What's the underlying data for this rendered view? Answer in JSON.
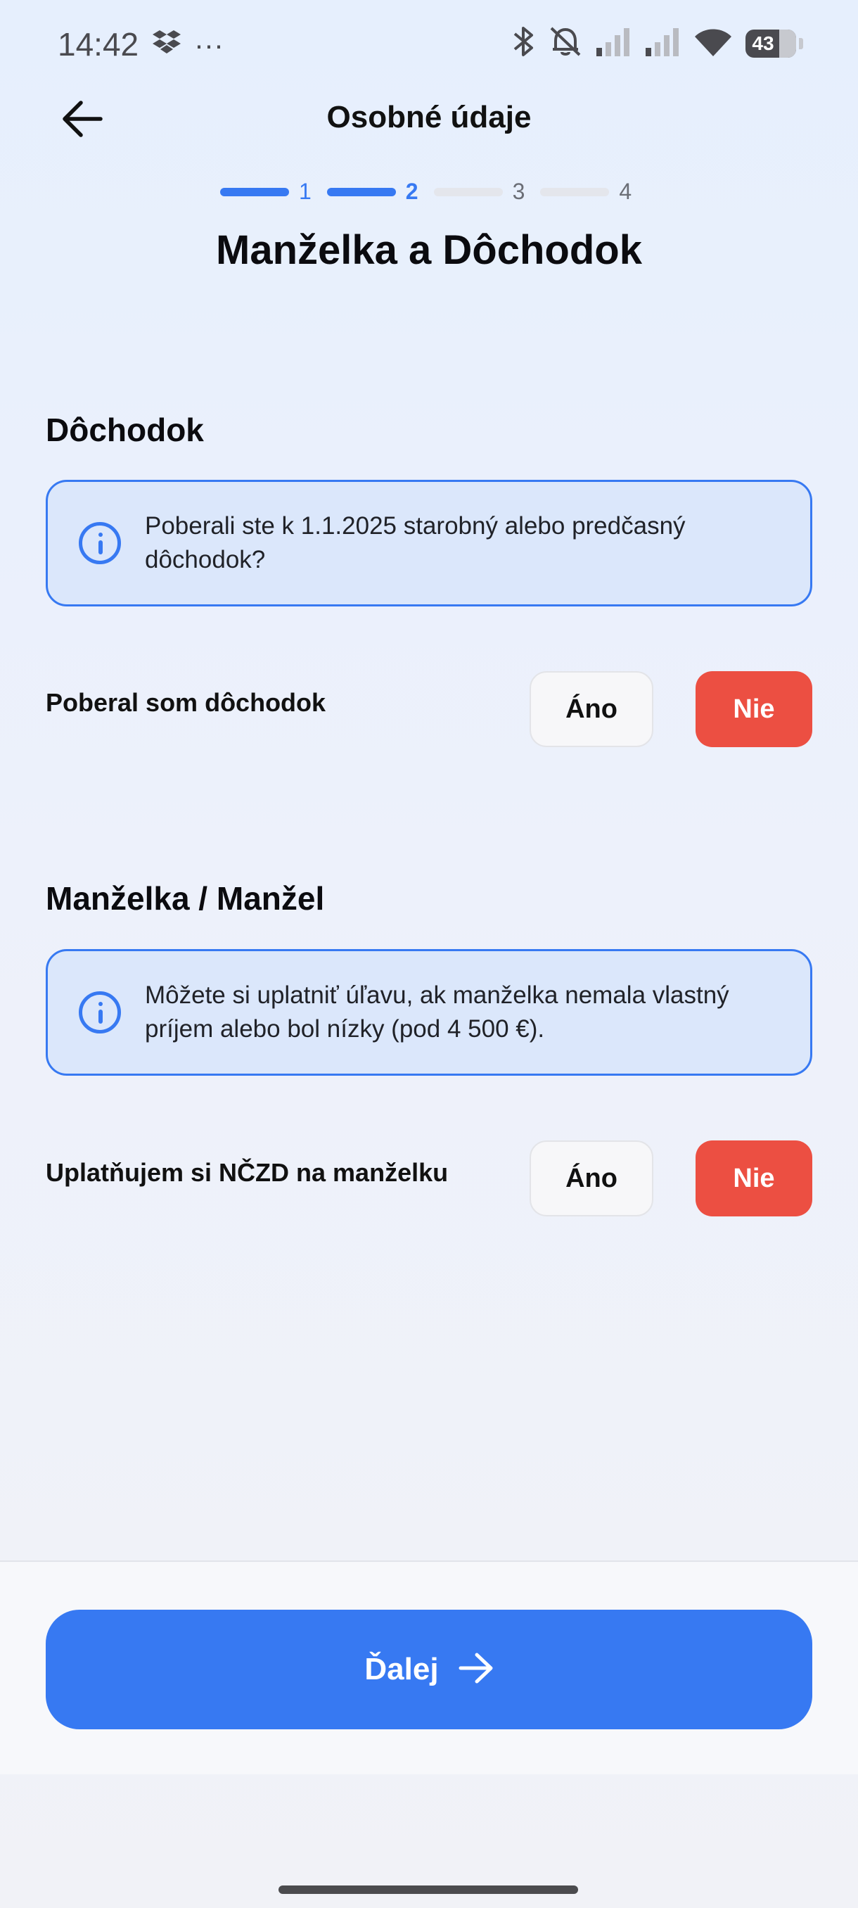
{
  "status_bar": {
    "time": "14:42",
    "overflow": "···",
    "battery": "43",
    "icons": [
      "dropbox-icon",
      "bluetooth-icon",
      "bell-muted-icon",
      "signal-icon",
      "signal-icon",
      "wifi-icon",
      "battery-icon"
    ]
  },
  "header": {
    "title": "Osobné údaje",
    "back_icon": "arrow-left-icon"
  },
  "stepper": {
    "steps": [
      {
        "label": "1",
        "state": "done"
      },
      {
        "label": "2",
        "state": "current"
      },
      {
        "label": "3",
        "state": "upcoming"
      },
      {
        "label": "4",
        "state": "upcoming"
      }
    ]
  },
  "main_heading": "Manželka a Dôchodok",
  "pension": {
    "title": "Dôchodok",
    "info": "Poberali ste k 1.1.2025 starobný alebo predčasný dôchodok?",
    "question": "Poberal som dôchodok",
    "yes_label": "Áno",
    "no_label": "Nie",
    "selected": "Nie"
  },
  "spouse": {
    "title": "Manželka / Manžel",
    "info": "Môžete si uplatniť úľavu, ak manželka nemala vlastný príjem alebo bol nízky (pod 4 500 €).",
    "question": "Uplatňujem si NČZD na manželku",
    "yes_label": "Áno",
    "no_label": "Nie",
    "selected": "Nie"
  },
  "footer": {
    "next_label": "Ďalej",
    "next_icon": "arrow-right-icon"
  },
  "colors": {
    "accent": "#3779f2",
    "danger": "#ec4f42",
    "info_bg": "#dbe7fb"
  }
}
